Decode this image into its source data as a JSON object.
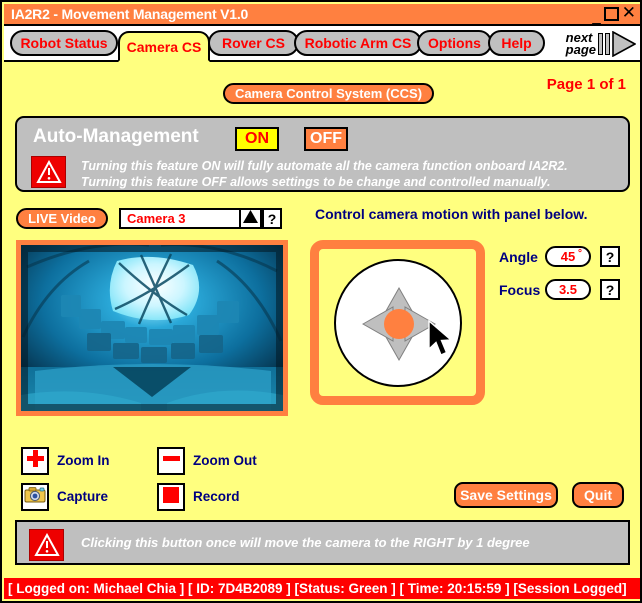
{
  "window": {
    "title": "IA2R2 - Movement Management V1.0",
    "controls": {
      "minimize": "_",
      "maximize": "",
      "close": "✕"
    }
  },
  "tabs": [
    {
      "label": "Robot Status",
      "active": false
    },
    {
      "label": "Camera CS",
      "active": true
    },
    {
      "label": "Rover CS",
      "active": false
    },
    {
      "label": "Robotic Arm CS",
      "active": false
    },
    {
      "label": "Options",
      "active": false
    },
    {
      "label": "Help",
      "active": false
    }
  ],
  "next_page": {
    "line1": "next",
    "line2": "page"
  },
  "header": {
    "badge": "Camera Control System (CCS)",
    "page_indicator": "Page 1 of 1"
  },
  "auto_management": {
    "title": "Auto-Management",
    "on_label": "ON",
    "off_label": "OFF",
    "description_line1": "Turning this feature ON will fully automate all the camera function onboard IA2R2.",
    "description_line2": "Turning this feature OFF allows settings to be change and controlled manually."
  },
  "live_video": {
    "badge": "LIVE Video",
    "camera_selected": "Camera 3",
    "help_label": "?"
  },
  "motion": {
    "instruction": "Control camera motion with panel below.",
    "angle_label": "Angle",
    "angle_value": "45",
    "angle_unit": "°",
    "angle_help": "?",
    "focus_label": "Focus",
    "focus_value": "3.5",
    "focus_help": "?"
  },
  "camera_buttons": [
    {
      "label": "Zoom In",
      "icon": "plus-icon"
    },
    {
      "label": "Zoom Out",
      "icon": "minus-icon"
    },
    {
      "label": "Capture",
      "icon": "camera-icon"
    },
    {
      "label": "Record",
      "icon": "stop-square-icon"
    }
  ],
  "actions": {
    "save": "Save Settings",
    "quit": "Quit"
  },
  "tip": {
    "text": "Clicking this button once will move the camera to the RIGHT by 1 degree"
  },
  "statusbar": {
    "text": "[ Logged on: Michael Chia ] [ ID: 7D4B2089 ] [Status: Green ] [ Time: 20:15:59 ] [Session Logged]"
  },
  "colors": {
    "accent_orange": "#ff8040",
    "page_yellow": "#ffff7f",
    "panel_gray": "#bfbfbf",
    "alert_red": "#ff0000",
    "label_navy": "#000080"
  }
}
